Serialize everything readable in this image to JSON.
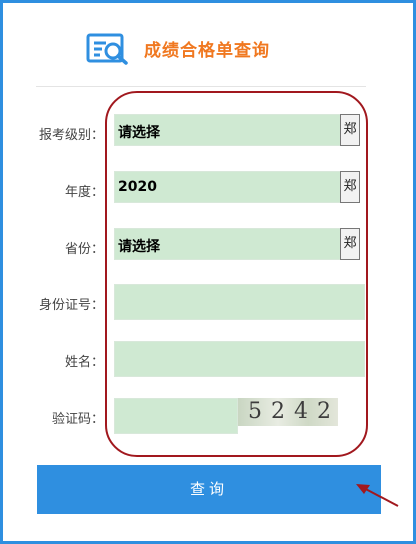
{
  "header": {
    "title": "成绩合格单查询",
    "logo_icon": "search-document-icon"
  },
  "form": {
    "exam_level": {
      "label": "报考级别：",
      "value": "请选择",
      "dropdown_glyph": "郑"
    },
    "year": {
      "label": "年度：",
      "value": "2020",
      "dropdown_glyph": "郑"
    },
    "province": {
      "label": "省份：",
      "value": "请选择",
      "dropdown_glyph": "郑"
    },
    "id_number": {
      "label": "身份证号：",
      "value": ""
    },
    "name": {
      "label": "姓名：",
      "value": ""
    },
    "captcha": {
      "label": "验证码：",
      "value": "",
      "image_text": "5242"
    }
  },
  "actions": {
    "query_label": "查询"
  },
  "colors": {
    "accent": "#2f8fe0",
    "title": "#f07820",
    "field_bg": "#cfe9d2",
    "highlight": "#a1181e"
  }
}
